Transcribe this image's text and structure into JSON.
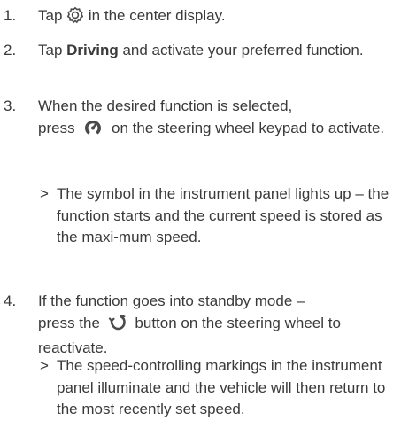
{
  "steps": [
    {
      "number": "1.",
      "before": "Tap",
      "icon": "settings-gear-icon",
      "after": "in the center display."
    },
    {
      "number": "2.",
      "before": "Tap",
      "bold": "Driving",
      "after": "and activate your preferred function."
    },
    {
      "number": "3.",
      "line1": "When the desired function is selected,",
      "before": "press",
      "icon": "cruise-control-icon",
      "after": "on the steering wheel keypad to activate.",
      "result_marker": ">",
      "result": "The symbol in the instrument panel lights up – the function starts and the current speed is stored as the maxi-mum speed."
    },
    {
      "number": "4.",
      "line1": "If the function goes into standby mode –",
      "before": "press the",
      "icon": "resume-icon",
      "after": "button on the steering wheel to reactivate.",
      "result_marker": ">",
      "result": "The speed-controlling markings in the instrument panel illuminate and the vehicle will then return to the most recently set speed."
    }
  ],
  "colors": {
    "text": "#3a3a3a",
    "icon": "#4a4a4a"
  }
}
